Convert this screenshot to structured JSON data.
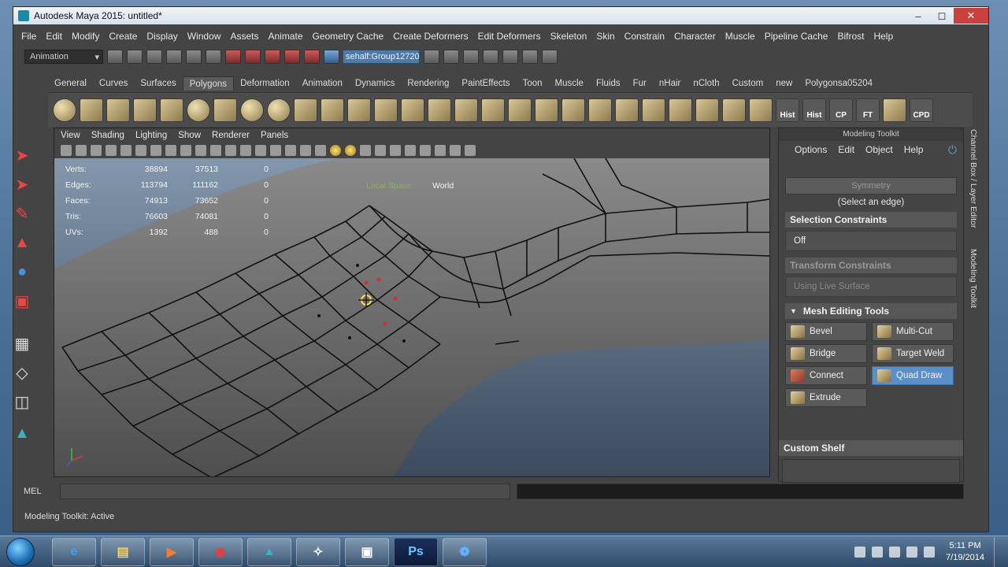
{
  "window": {
    "title": "Autodesk Maya 2015: untitled*"
  },
  "menubar": [
    "File",
    "Edit",
    "Modify",
    "Create",
    "Display",
    "Window",
    "Assets",
    "Animate",
    "Geometry Cache",
    "Create Deformers",
    "Edit Deformers",
    "Skeleton",
    "Skin",
    "Constrain",
    "Character",
    "Muscle",
    "Pipeline Cache",
    "Bifrost",
    "Help"
  ],
  "statusline": {
    "mode": "Animation",
    "selection_field": "sehalf:Group12720"
  },
  "shelf_tabs": [
    "General",
    "Curves",
    "Surfaces",
    "Polygons",
    "Deformation",
    "Animation",
    "Dynamics",
    "Rendering",
    "PaintEffects",
    "Toon",
    "Muscle",
    "Fluids",
    "Fur",
    "nHair",
    "nCloth",
    "Custom",
    "new",
    "Polygonsa05204"
  ],
  "shelf_active_tab": "Polygons",
  "shelf_text_icons": [
    "Hist",
    "Hist",
    "CP",
    "FT",
    "CPD"
  ],
  "viewport": {
    "menu": [
      "View",
      "Shading",
      "Lighting",
      "Show",
      "Renderer",
      "Panels"
    ],
    "hud": [
      {
        "label": "Verts:",
        "v1": "38894",
        "v2": "37513",
        "v3": "0"
      },
      {
        "label": "Edges:",
        "v1": "113794",
        "v2": "111162",
        "v3": "0"
      },
      {
        "label": "Faces:",
        "v1": "74913",
        "v2": "73652",
        "v3": "0"
      },
      {
        "label": "Tris:",
        "v1": "76603",
        "v2": "74081",
        "v3": "0"
      },
      {
        "label": "UVs:",
        "v1": "1392",
        "v2": "488",
        "v3": "0"
      }
    ],
    "space_label": "Local Space",
    "space_value": "World"
  },
  "modeling_toolkit": {
    "title": "Modeling Toolkit",
    "menu": [
      "Options",
      "Edit",
      "Object",
      "Help"
    ],
    "symmetry_button": "Symmetry",
    "select_note": "(Select an edge)",
    "selection_constraints": "Selection Constraints",
    "constraint_value": "Off",
    "transform_constraints": "Transform Constraints",
    "transform_value": "Using Live Surface",
    "mesh_editing_tools": "Mesh Editing Tools",
    "tools": [
      "Bevel",
      "Multi-Cut",
      "Bridge",
      "Target Weld",
      "Connect",
      "Quad Draw",
      "Extrude"
    ],
    "active_tool": "Quad Draw",
    "custom_shelf": "Custom Shelf"
  },
  "side_tabs": [
    "Channel Box / Layer Editor",
    "Modeling Toolkit"
  ],
  "cmdline": {
    "label": "MEL"
  },
  "helpline": "Modeling Toolkit: Active",
  "taskbar": {
    "time": "5:11 PM",
    "date": "7/19/2014"
  }
}
